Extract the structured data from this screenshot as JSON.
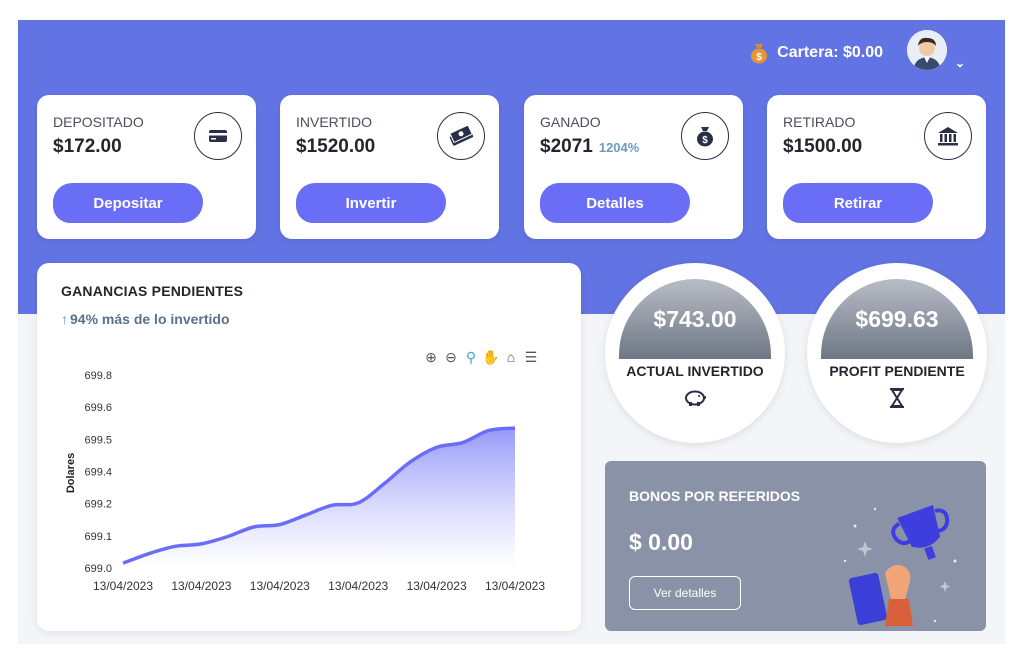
{
  "header": {
    "wallet_label": "Cartera: $0.00"
  },
  "cards": [
    {
      "title": "DEPOSITADO",
      "value": "$172.00",
      "pct": "",
      "icon": "credit-card-icon",
      "button": "Depositar"
    },
    {
      "title": "INVERTIDO",
      "value": "$1520.00",
      "pct": "",
      "icon": "cash-stack-icon",
      "button": "Invertir"
    },
    {
      "title": "GANADO",
      "value": "$2071",
      "pct": "1204%",
      "icon": "money-bag-icon",
      "button": "Detalles"
    },
    {
      "title": "RETIRADO",
      "value": "$1500.00",
      "pct": "",
      "icon": "bank-icon",
      "button": "Retirar"
    }
  ],
  "earnings": {
    "title": "GANANCIAS PENDIENTES",
    "subtitle": "94% más de lo invertido"
  },
  "chart_data": {
    "type": "area",
    "ylabel": "Dolares",
    "xlabel": "",
    "x_tick_labels": [
      "13/04/2023",
      "13/04/2023",
      "13/04/2023",
      "13/04/2023",
      "13/04/2023",
      "13/04/2023"
    ],
    "y_tick_labels": [
      "699.0",
      "699.1",
      "699.2",
      "699.4",
      "699.5",
      "699.6",
      "699.8"
    ],
    "ylim": [
      699.0,
      699.8
    ],
    "values": [
      699.02,
      699.06,
      699.09,
      699.1,
      699.13,
      699.17,
      699.18,
      699.22,
      699.26,
      699.27,
      699.35,
      699.44,
      699.5,
      699.52,
      699.57,
      699.58
    ],
    "color": "#6a6ef6"
  },
  "stats": [
    {
      "value": "$743.00",
      "label": "ACTUAL INVERTIDO",
      "icon": "piggy-bank-icon"
    },
    {
      "value": "$699.63",
      "label": "PROFIT PENDIENTE",
      "icon": "hourglass-icon"
    }
  ],
  "referral": {
    "title": "BONOS POR REFERIDOS",
    "amount": "$ 0.00",
    "button": "Ver detalles"
  },
  "colors": {
    "brand": "#6273e3",
    "button": "#6a6ef6",
    "referral_bg": "#8a92a8"
  }
}
